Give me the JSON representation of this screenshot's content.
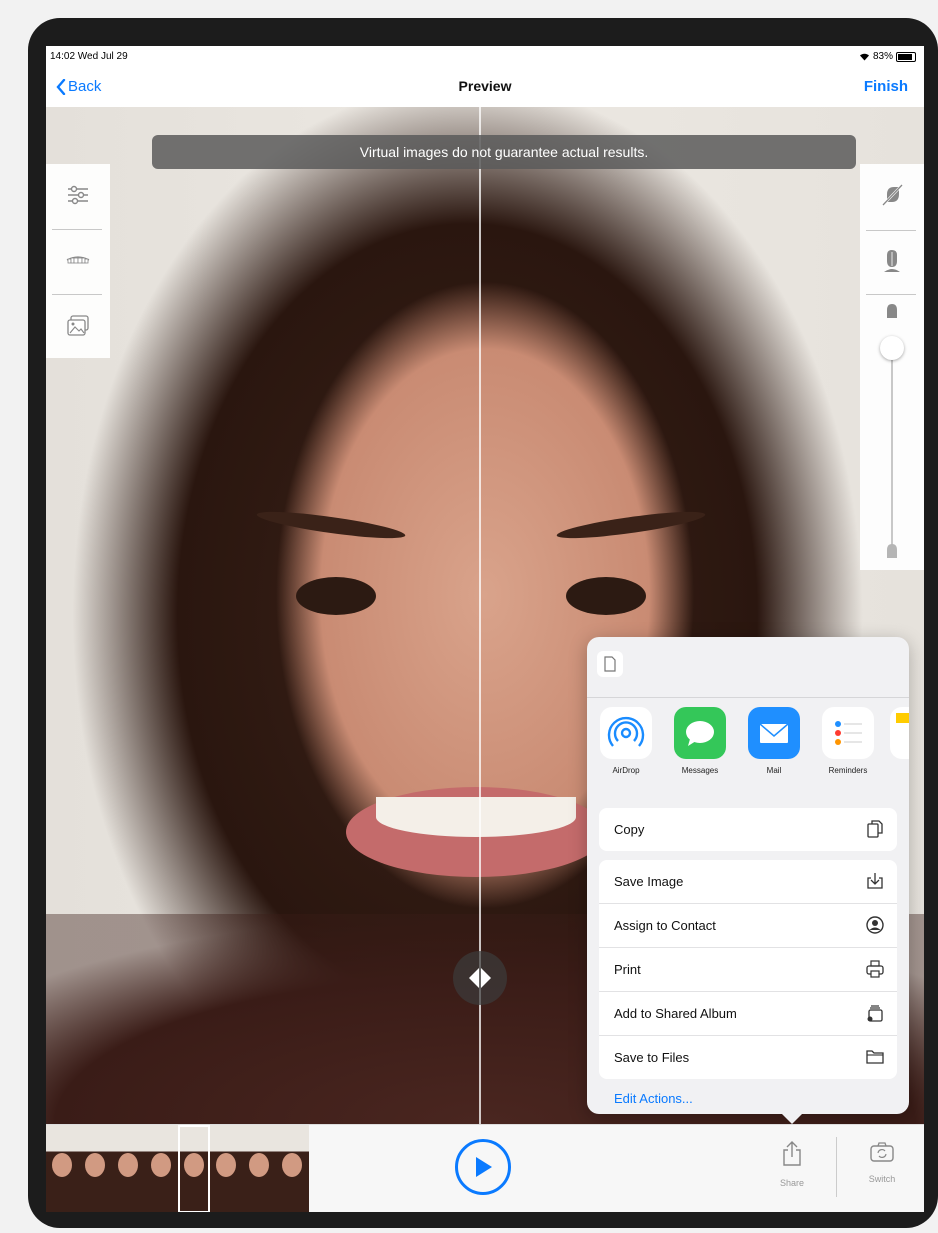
{
  "status_bar": {
    "time": "14:02  Wed Jul 29",
    "battery": "83%"
  },
  "nav": {
    "back_label": "Back",
    "title": "Preview",
    "finish_label": "Finish"
  },
  "banner": {
    "text": "Virtual images do not guarantee actual results."
  },
  "left_tools": [
    {
      "icon": "sliders-icon"
    },
    {
      "icon": "teeth-icon"
    },
    {
      "icon": "gallery-icon"
    }
  ],
  "right_tools": {
    "icons": [
      "no-retouch-icon",
      "face-outline-icon"
    ],
    "slider_level": 0.0
  },
  "share_sheet": {
    "apps": [
      {
        "label": "AirDrop",
        "icon": "airdrop-icon",
        "color": "#1a8cff"
      },
      {
        "label": "Messages",
        "icon": "messages-icon",
        "color": "#34c759"
      },
      {
        "label": "Mail",
        "icon": "mail-icon",
        "color": "#1f8fff"
      },
      {
        "label": "Reminders",
        "icon": "reminders-icon",
        "color": "#ffffff"
      }
    ],
    "copy_label": "Copy",
    "actions": [
      {
        "label": "Save Image",
        "icon": "save-image-icon"
      },
      {
        "label": "Assign to Contact",
        "icon": "contact-icon"
      },
      {
        "label": "Print",
        "icon": "print-icon"
      },
      {
        "label": "Add to Shared Album",
        "icon": "shared-album-icon"
      },
      {
        "label": "Save to Files",
        "icon": "folder-icon"
      }
    ],
    "edit_actions_label": "Edit Actions..."
  },
  "bottom_bar": {
    "share_label": "Share",
    "switch_label": "Switch"
  },
  "colors": {
    "accent": "#0a7aff"
  }
}
